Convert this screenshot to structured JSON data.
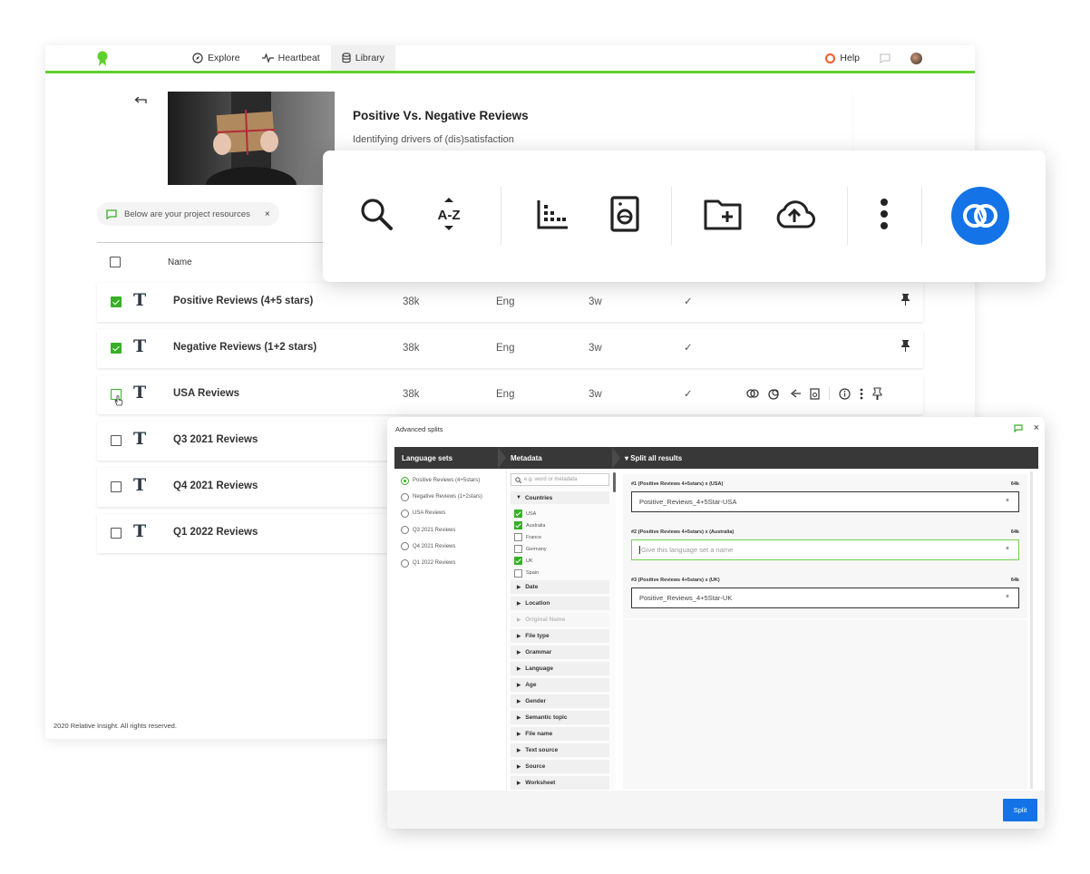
{
  "nav": {
    "explore": "Explore",
    "heartbeat": "Heartbeat",
    "library": "Library",
    "help": "Help"
  },
  "hero": {
    "title": "Positive Vs. Negative Reviews",
    "subtitle": "Identifying drivers of (dis)satisfaction"
  },
  "notice": {
    "text": "Below are your project resources",
    "close": "×"
  },
  "table_header": {
    "name": "Name"
  },
  "rows": [
    {
      "name": "Positive Reviews (4+5 stars)",
      "size": "38k",
      "lang": "Eng",
      "age": "3w",
      "checked": true
    },
    {
      "name": "Negative Reviews (1+2 stars)",
      "size": "38k",
      "lang": "Eng",
      "age": "3w",
      "checked": true
    },
    {
      "name": "USA Reviews",
      "size": "38k",
      "lang": "Eng",
      "age": "3w",
      "checked": false
    },
    {
      "name": "Q3 2021 Reviews",
      "checked": false
    },
    {
      "name": "Q4 2021 Reviews",
      "checked": false
    },
    {
      "name": "Q1 2022 Reviews",
      "checked": false
    }
  ],
  "row_check": "✓",
  "footer": "2020 Relative Insight. All rights reserved.",
  "toolbar": {
    "sort_label": "A-Z",
    "icons": [
      "search-icon",
      "sort-az-icon",
      "histogram-icon",
      "document-preview-icon",
      "new-folder-icon",
      "cloud-upload-icon",
      "more-vertical-icon",
      "split-icon"
    ]
  },
  "colors": {
    "accent_green": "#5fcf2b",
    "check_green": "#37b027",
    "primary_blue": "#1473e6",
    "header_dark": "#383838"
  },
  "modal": {
    "title": "Advanced splits",
    "close": "×",
    "headers": [
      "Language sets",
      "Metadata",
      "▾ Split all results"
    ],
    "language_sets": [
      "Positive Reviews (4+5stars)",
      "Negative Reviews (1+2stars)",
      "USA Reviews",
      "Q3 2021 Reviews",
      "Q4 2021 Reviews",
      "Q1 2022 Reviews"
    ],
    "search_placeholder": "e.g. word or metadata",
    "countries_label": "Countries",
    "countries": [
      {
        "name": "USA",
        "checked": true
      },
      {
        "name": "Australia",
        "checked": true
      },
      {
        "name": "France",
        "checked": false
      },
      {
        "name": "Germany",
        "checked": false
      },
      {
        "name": "UK",
        "checked": true
      },
      {
        "name": "Spain",
        "checked": false
      }
    ],
    "sections": [
      "Date",
      "Location",
      "Original Name",
      "File type",
      "Grammar",
      "Language",
      "Age",
      "Gender",
      "Semantic topic",
      "File name",
      "Text source",
      "Source",
      "Worksheet"
    ],
    "results": [
      {
        "label": "#1 (Positive Reviews 4+5stars) x (USA)",
        "size": "64k",
        "value": "Positive_Reviews_4+5Star-USA"
      },
      {
        "label": "#2 (Positive Reviews 4+5stars) x (Australia)",
        "size": "64k",
        "placeholder": "Give this language set a name"
      },
      {
        "label": "#3 (Positive Reviews 4+5stars) x (UK)",
        "size": "64k",
        "value": "Positive_Reviews_4+5Star-UK"
      }
    ],
    "input_clear": "×",
    "split_button": "Split"
  }
}
